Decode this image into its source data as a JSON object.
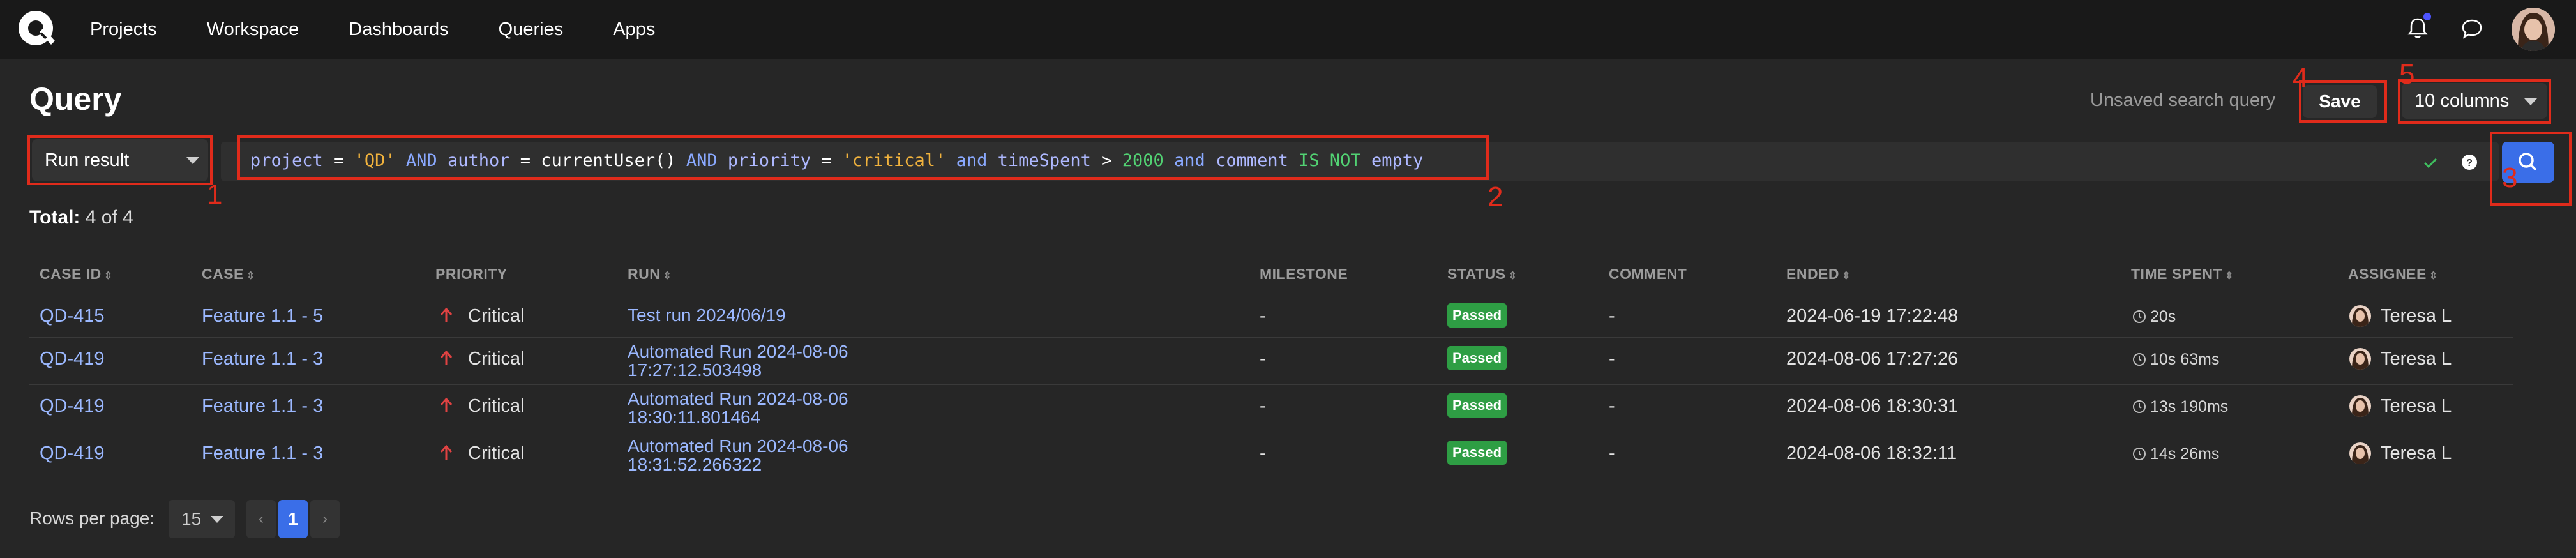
{
  "nav": {
    "items": [
      "Projects",
      "Workspace",
      "Dashboards",
      "Queries",
      "Apps"
    ]
  },
  "header": {
    "title": "Query",
    "unsaved": "Unsaved search query",
    "save_label": "Save",
    "columns_selected": "10 columns"
  },
  "search": {
    "run_type_selected": "Run result",
    "query": {
      "project_kw": "project",
      "eq1": "=",
      "project_val": "'QD'",
      "and1": "AND",
      "author_kw": "author",
      "eq2": "=",
      "author_fn": "currentUser()",
      "and2": "AND",
      "priority_kw": "priority",
      "eq3": "=",
      "priority_val": "'critical'",
      "and3": "and",
      "time_kw": "timeSpent",
      "gt": ">",
      "time_val": "2000",
      "and4": "and",
      "comment_kw": "comment",
      "is_not": "IS NOT",
      "empty_kw": "empty"
    }
  },
  "total": {
    "label": "Total:",
    "value": "4 of 4"
  },
  "table": {
    "headers": [
      "CASE ID",
      "CASE",
      "PRIORITY",
      "RUN",
      "MILESTONE",
      "STATUS",
      "COMMENT",
      "ENDED",
      "TIME SPENT",
      "ASSIGNEE"
    ],
    "rows": [
      {
        "case_id": "QD-415",
        "case": "Feature 1.1 - 5",
        "priority": "Critical",
        "run_line1": "Test run 2024/06/19",
        "run_line2": "",
        "milestone": "-",
        "status": "Passed",
        "comment": "-",
        "ended": "2024-06-19 17:22:48",
        "time_spent": "20s",
        "assignee": "Teresa L"
      },
      {
        "case_id": "QD-419",
        "case": "Feature 1.1 - 3",
        "priority": "Critical",
        "run_line1": "Automated Run 2024-08-06",
        "run_line2": "17:27:12.503498",
        "milestone": "-",
        "status": "Passed",
        "comment": "-",
        "ended": "2024-08-06 17:27:26",
        "time_spent": "10s 63ms",
        "assignee": "Teresa L"
      },
      {
        "case_id": "QD-419",
        "case": "Feature 1.1 - 3",
        "priority": "Critical",
        "run_line1": "Automated Run 2024-08-06",
        "run_line2": "18:30:11.801464",
        "milestone": "-",
        "status": "Passed",
        "comment": "-",
        "ended": "2024-08-06 18:30:31",
        "time_spent": "13s 190ms",
        "assignee": "Teresa L"
      },
      {
        "case_id": "QD-419",
        "case": "Feature 1.1 - 3",
        "priority": "Critical",
        "run_line1": "Automated Run 2024-08-06",
        "run_line2": "18:31:52.266322",
        "milestone": "-",
        "status": "Passed",
        "comment": "-",
        "ended": "2024-08-06 18:32:11",
        "time_spent": "14s 26ms",
        "assignee": "Teresa L"
      }
    ]
  },
  "pagination": {
    "rows_per_page_label": "Rows per page:",
    "rows_per_page_value": "15",
    "prev": "‹",
    "current": "1",
    "next": "›"
  },
  "annotations": [
    "1",
    "2",
    "3",
    "4",
    "5"
  ],
  "colors": {
    "accent": "#3a6ee8",
    "passed": "#2e9e44",
    "annotation": "#e02b1b",
    "priority_critical": "#e04242"
  }
}
